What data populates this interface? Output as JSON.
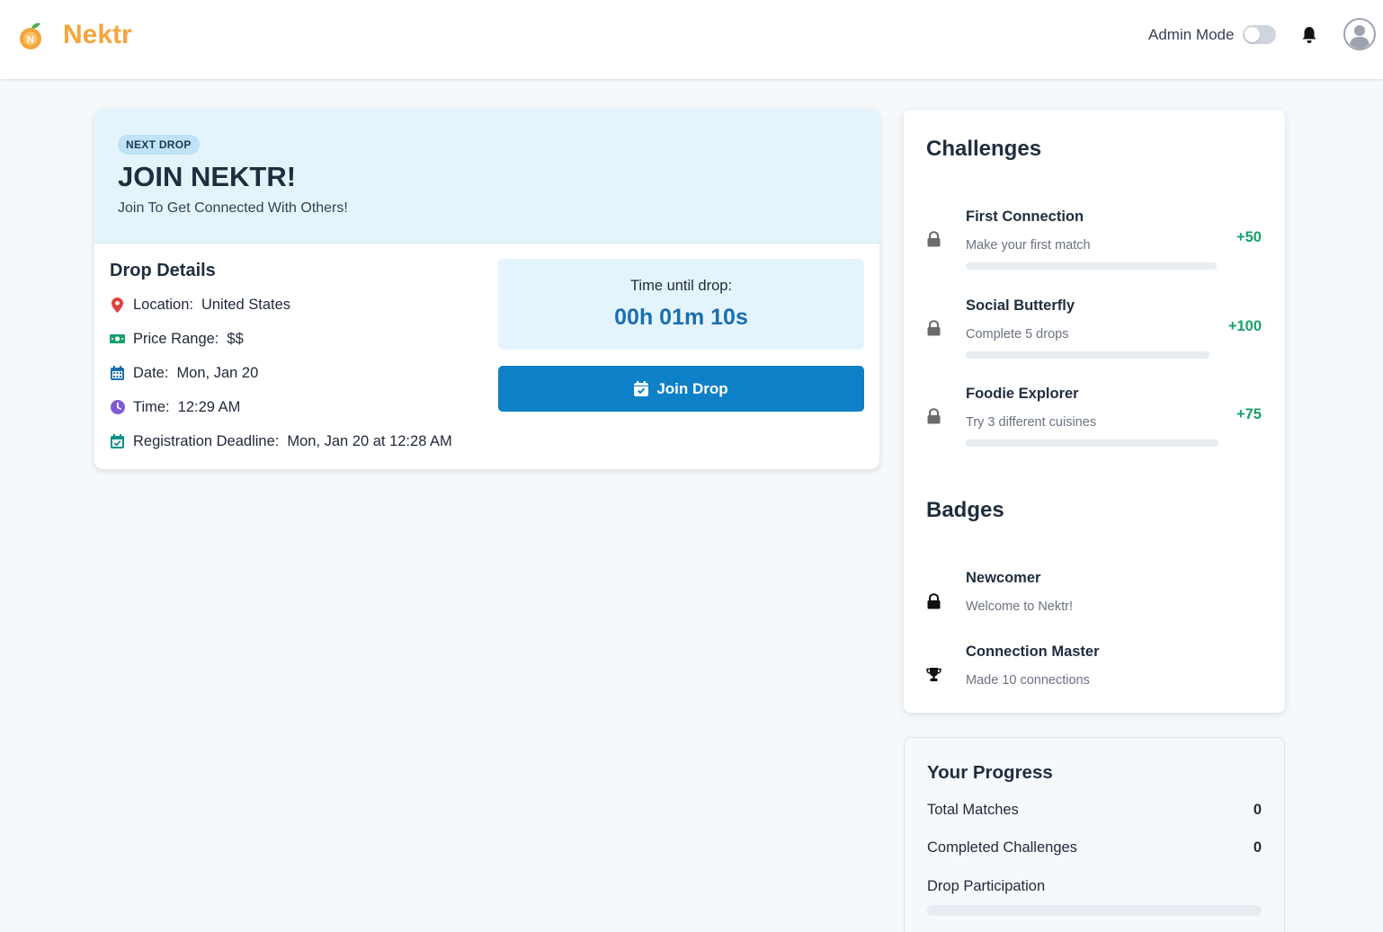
{
  "header": {
    "brand": "Nektr",
    "admin_label": "Admin Mode",
    "admin_mode_on": false,
    "icons": [
      "peach-logo-icon",
      "bell-icon",
      "user-avatar-icon"
    ]
  },
  "drop": {
    "pill": "NEXT DROP",
    "title": "JOIN NEKTR!",
    "subtitle": "Join To Get Connected With Others!",
    "details_title": "Drop Details",
    "details": [
      {
        "label": "Location:",
        "value": "United States",
        "icon": "map-pin-icon",
        "color": "#e53e3e"
      },
      {
        "label": "Price Range:",
        "value": "$$",
        "icon": "money-icon",
        "color": "#16a06a"
      },
      {
        "label": "Date:",
        "value": "Mon, Jan 20",
        "icon": "calendar-icon",
        "color": "#1a6fb0"
      },
      {
        "label": "Time:",
        "value": "12:29 AM",
        "icon": "clock-icon",
        "color": "#805ad5"
      },
      {
        "label": "Registration Deadline:",
        "value": "Mon, Jan 20 at 12:28 AM",
        "icon": "calendar-check-icon",
        "color": "#0d9488"
      }
    ],
    "timer_label": "Time until drop:",
    "timer_value": "00h 01m 10s",
    "join_label": "Join Drop"
  },
  "challenges": {
    "title": "Challenges",
    "items": [
      {
        "name": "First Connection",
        "desc": "Make your first match",
        "points": "+50",
        "progress": 0
      },
      {
        "name": "Social Butterfly",
        "desc": "Complete 5 drops",
        "points": "+100",
        "progress": 0
      },
      {
        "name": "Foodie Explorer",
        "desc": "Try 3 different cuisines",
        "points": "+75",
        "progress": 0
      }
    ]
  },
  "badges": {
    "title": "Badges",
    "items": [
      {
        "name": "Newcomer",
        "desc": "Welcome to Nektr!",
        "icon": "lock-icon"
      },
      {
        "name": "Connection Master",
        "desc": "Made 10 connections",
        "icon": "trophy-icon"
      }
    ]
  },
  "progress": {
    "title": "Your Progress",
    "total_matches_label": "Total Matches",
    "total_matches": "0",
    "completed_label": "Completed Challenges",
    "completed": "0",
    "participation_label": "Drop Participation",
    "participation": 0
  },
  "colors": {
    "brand": "#f6a53b",
    "primary": "#0e80c8",
    "points": "#16a06a",
    "banner": "#e4f4fd"
  }
}
